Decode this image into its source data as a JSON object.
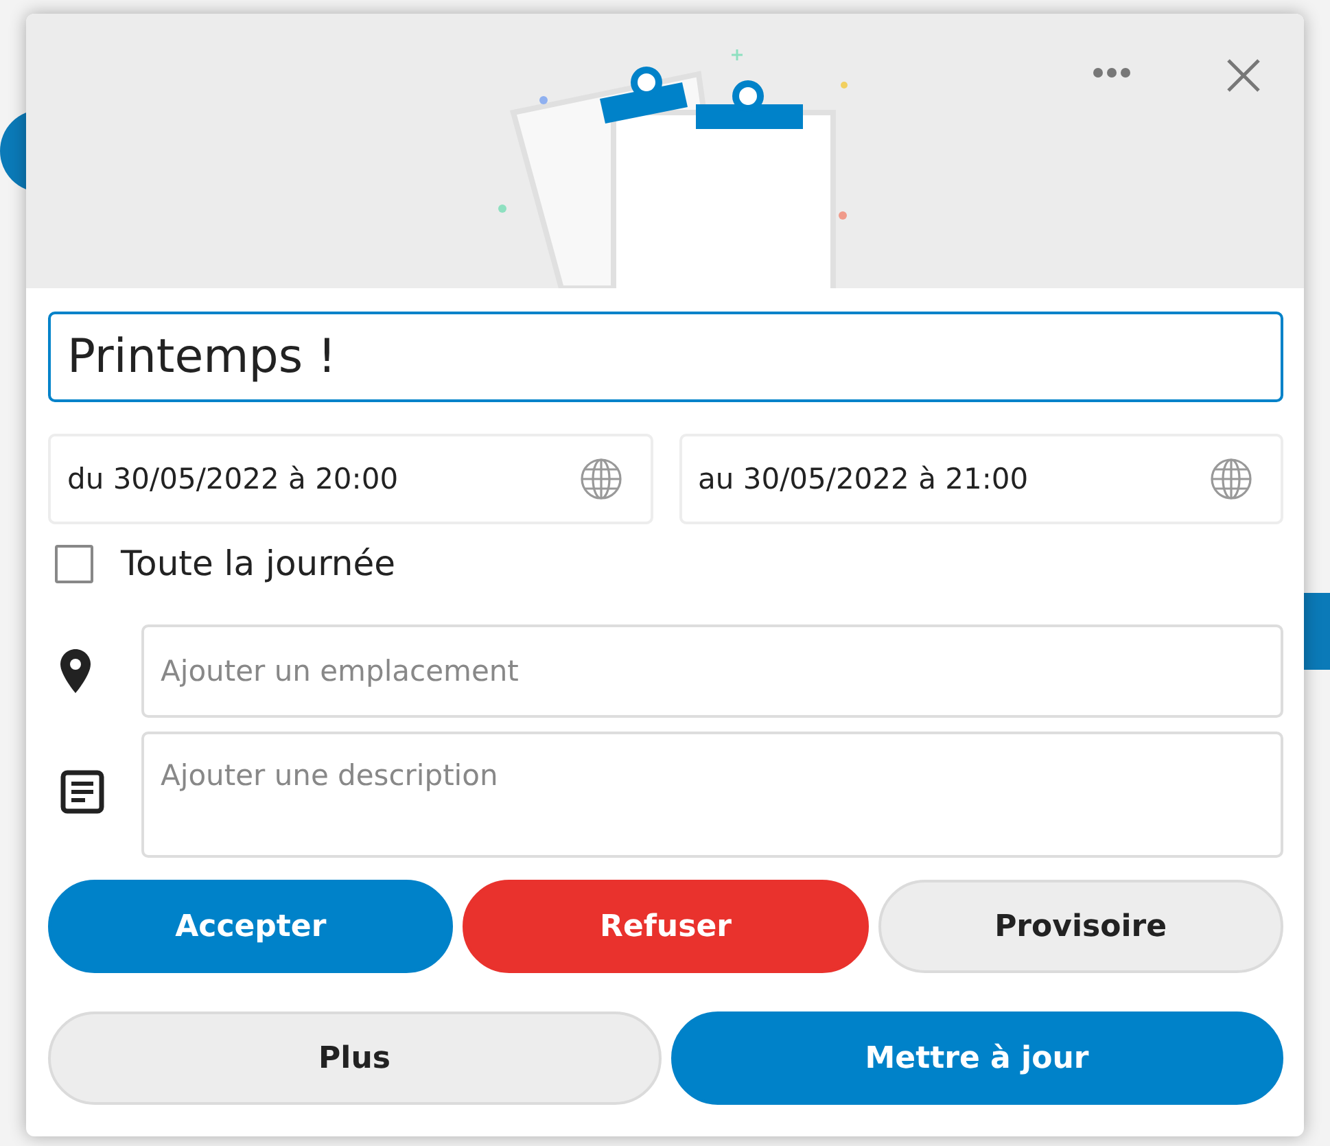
{
  "title": {
    "value": "Printemps !"
  },
  "start": {
    "value": "du 30/05/2022 à 20:00"
  },
  "end": {
    "value": "au 30/05/2022 à 21:00"
  },
  "all_day": {
    "label": "Toute la journée",
    "checked": false
  },
  "location": {
    "placeholder": "Ajouter un emplacement"
  },
  "description": {
    "placeholder": "Ajouter une description"
  },
  "actions": [
    {
      "label": "Accepter",
      "kind": "primary"
    },
    {
      "label": "Refuser",
      "kind": "danger"
    },
    {
      "label": "Provisoire",
      "kind": "neutral"
    }
  ],
  "footer": [
    {
      "label": "Plus",
      "kind": "neutral"
    },
    {
      "label": "Mettre à jour",
      "kind": "primary"
    }
  ]
}
